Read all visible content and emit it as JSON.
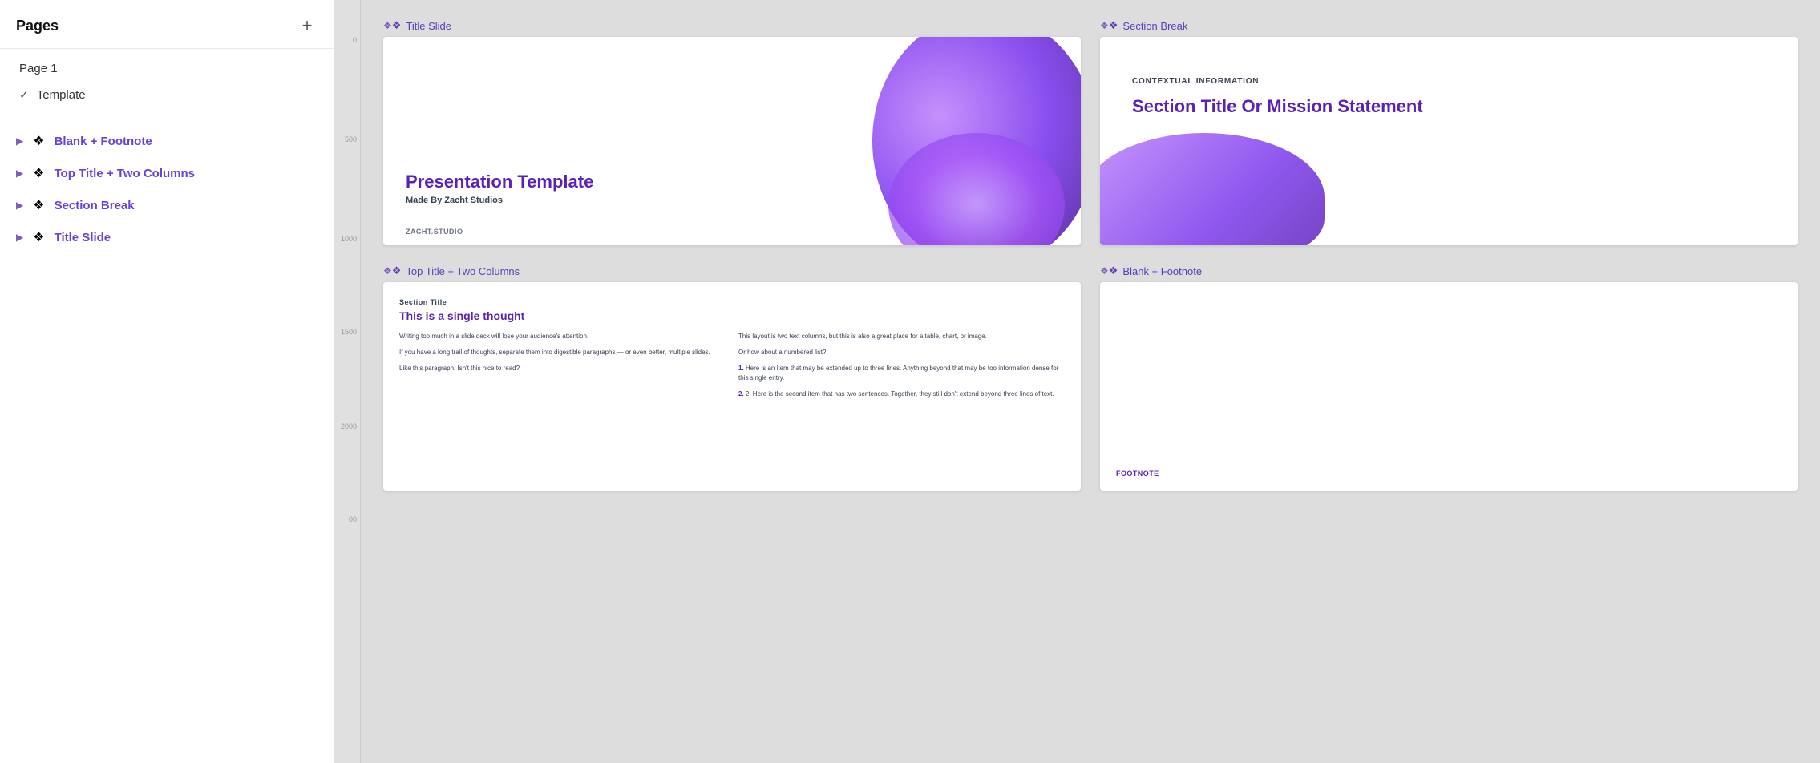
{
  "sidebar": {
    "title": "Pages",
    "add_button_label": "+",
    "pages": [
      {
        "id": "page1",
        "label": "Page 1",
        "active": false,
        "checked": false
      },
      {
        "id": "template",
        "label": "Template",
        "active": true,
        "checked": true
      }
    ],
    "layouts": [
      {
        "id": "blank-footnote",
        "label": "Blank + Footnote"
      },
      {
        "id": "top-title-two-columns",
        "label": "Top Title + Two Columns"
      },
      {
        "id": "section-break",
        "label": "Section Break"
      },
      {
        "id": "title-slide",
        "label": "Title Slide"
      }
    ]
  },
  "slides": {
    "title_slide": {
      "label": "Title Slide",
      "title": "Presentation Template",
      "subtitle": "Made By Zacht Studios",
      "footer": "ZACHT.STUDIO"
    },
    "section_break": {
      "label": "Section Break",
      "context_label": "CONTEXTUAL INFORMATION",
      "title": "Section Title Or Mission Statement"
    },
    "two_columns": {
      "label": "Top Title + Two Columns",
      "section_label": "Section Title",
      "heading": "This is a single thought",
      "left_col": [
        "Writing too much in a slide deck will lose your audience's attention.",
        "If you have a long trail of thoughts, separate them into digestible paragraphs — or even better, multiple slides.",
        "Like this paragraph. Isn't this nice to read?"
      ],
      "right_col": [
        "This layout is two text columns, but this is also a great place for a table, chart, or image.",
        "Or how about a numbered list?",
        "1. Here is an item that may be extended up to three lines. Anything beyond that may be too information dense for this single entry.",
        "2. Here is the second item that has two sentences. Together, they still don't extend beyond three lines of text."
      ]
    },
    "blank_footnote": {
      "label": "Blank + Footnote",
      "footer": "FOOTNOTE"
    }
  },
  "ruler": {
    "marks": [
      "0",
      "500",
      "1000",
      "1500",
      "2000",
      "00"
    ]
  },
  "colors": {
    "purple_primary": "#6842d6",
    "purple_dark": "#5b21b6",
    "purple_light": "#c084fc"
  }
}
